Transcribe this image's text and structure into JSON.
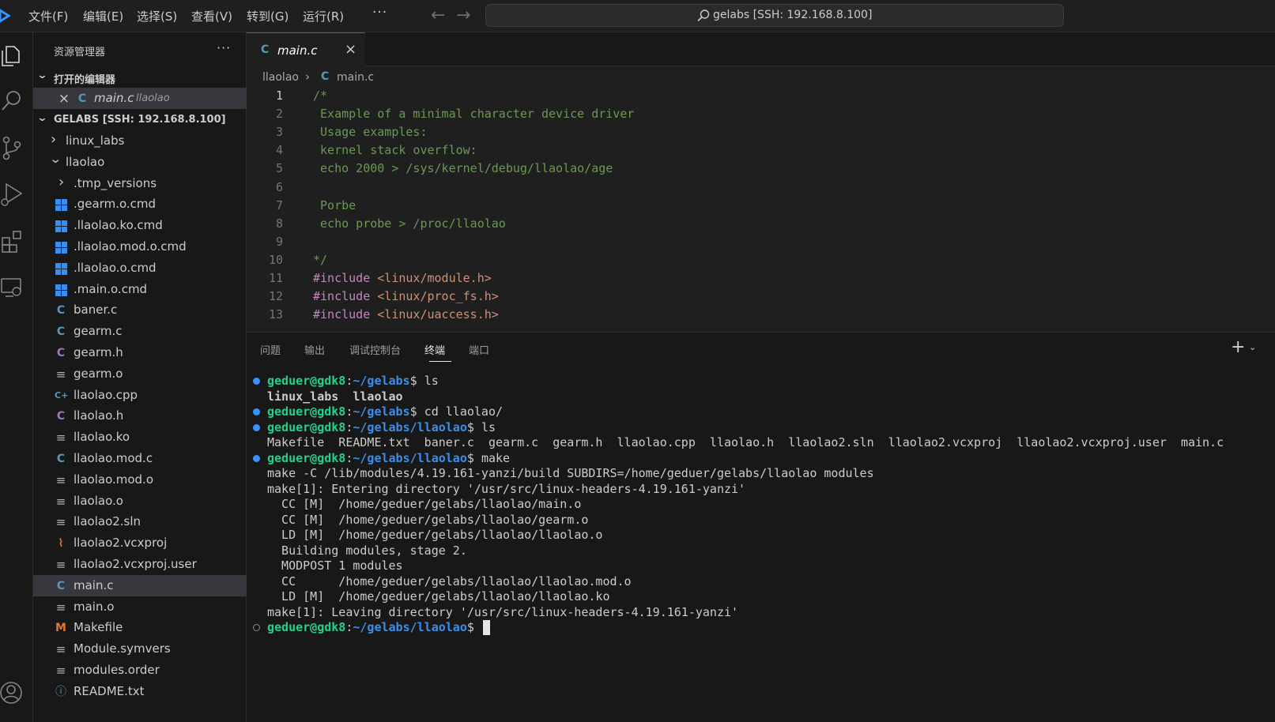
{
  "menu": {
    "items": [
      "文件(F)",
      "编辑(E)",
      "选择(S)",
      "查看(V)",
      "转到(G)",
      "运行(R)"
    ],
    "more": "···"
  },
  "command_center": {
    "text": "gelabs [SSH: 192.168.8.100]"
  },
  "sidebar": {
    "title": "资源管理器",
    "more": "···",
    "open_editors": {
      "header": "打开的编辑器",
      "items": [
        {
          "name": "main.c",
          "folder": "llaolao"
        }
      ]
    },
    "workspace": {
      "header": "GELABS [SSH: 192.168.8.100]",
      "items": [
        {
          "name": "linux_labs",
          "icon": "chevron-right-icon"
        },
        {
          "name": "llaolao",
          "icon": "chevron-down-icon"
        },
        {
          "name": ".tmp_versions",
          "icon": "chevron-right-icon"
        },
        {
          "name": ".gearm.o.cmd",
          "icon": "windows-icon"
        },
        {
          "name": ".llaolao.ko.cmd",
          "icon": "windows-icon"
        },
        {
          "name": ".llaolao.mod.o.cmd",
          "icon": "windows-icon"
        },
        {
          "name": ".llaolao.o.cmd",
          "icon": "windows-icon"
        },
        {
          "name": ".main.o.cmd",
          "icon": "windows-icon"
        },
        {
          "name": "baner.c",
          "icon": "c-file-icon"
        },
        {
          "name": "gearm.c",
          "icon": "c-file-icon"
        },
        {
          "name": "gearm.h",
          "icon": "h-file-icon"
        },
        {
          "name": "gearm.o",
          "icon": "text-file-icon"
        },
        {
          "name": "llaolao.cpp",
          "icon": "cpp-file-icon"
        },
        {
          "name": "llaolao.h",
          "icon": "h-file-icon"
        },
        {
          "name": "llaolao.ko",
          "icon": "text-file-icon"
        },
        {
          "name": "llaolao.mod.c",
          "icon": "c-file-icon"
        },
        {
          "name": "llaolao.mod.o",
          "icon": "text-file-icon"
        },
        {
          "name": "llaolao.o",
          "icon": "text-file-icon"
        },
        {
          "name": "llaolao2.sln",
          "icon": "text-file-icon"
        },
        {
          "name": "llaolao2.vcxproj",
          "icon": "rss-icon"
        },
        {
          "name": "llaolao2.vcxproj.user",
          "icon": "text-file-icon"
        },
        {
          "name": "main.c",
          "icon": "c-file-icon"
        },
        {
          "name": "main.o",
          "icon": "text-file-icon"
        },
        {
          "name": "Makefile",
          "icon": "makefile-icon"
        },
        {
          "name": "Module.symvers",
          "icon": "text-file-icon"
        },
        {
          "name": "modules.order",
          "icon": "text-file-icon"
        },
        {
          "name": "README.txt",
          "icon": "info-icon"
        }
      ]
    }
  },
  "editor": {
    "tab": {
      "label": "main.c",
      "icon": "C"
    },
    "breadcrumb": {
      "folder": "llaolao",
      "sep": "›",
      "icon": "C",
      "file": "main.c"
    },
    "lines": [
      {
        "n": "1",
        "text": "/*",
        "kind": "cm"
      },
      {
        "n": "2",
        "text": " Example of a minimal character device driver",
        "kind": "cm"
      },
      {
        "n": "3",
        "text": " Usage examples:",
        "kind": "cm"
      },
      {
        "n": "4",
        "text": " kernel stack overflow:",
        "kind": "cm"
      },
      {
        "n": "5",
        "text": " echo 2000 > /sys/kernel/debug/llaolao/age",
        "kind": "cm"
      },
      {
        "n": "6",
        "text": "",
        "kind": "cm"
      },
      {
        "n": "7",
        "text": " Porbe",
        "kind": "cm"
      },
      {
        "n": "8",
        "text": " echo probe > /proc/llaolao",
        "kind": "cm"
      },
      {
        "n": "9",
        "text": "",
        "kind": "cm"
      },
      {
        "n": "10",
        "text": "*/",
        "kind": "cm"
      },
      {
        "n": "11",
        "kw": "#include",
        "str": " <linux/module.h>",
        "kind": "inc"
      },
      {
        "n": "12",
        "kw": "#include",
        "str": " <linux/proc_fs.h>",
        "kind": "inc"
      },
      {
        "n": "13",
        "kw": "#include",
        "str": " <linux/uaccess.h>",
        "kind": "inc"
      }
    ]
  },
  "panel": {
    "tabs": [
      "问题",
      "输出",
      "调试控制台",
      "终端",
      "端口"
    ],
    "active_tab": "终端",
    "add": "+",
    "terminal": {
      "lines": [
        {
          "dot": "filled",
          "user": "geduer@gdk8",
          "path": "~/gelabs",
          "cmd": "ls"
        },
        {
          "dot": "",
          "dirs": "linux_labs  llaolao"
        },
        {
          "dot": "filled",
          "user": "geduer@gdk8",
          "path": "~/gelabs",
          "cmd": "cd llaolao/"
        },
        {
          "dot": "filled",
          "user": "geduer@gdk8",
          "path": "~/gelabs/llaolao",
          "cmd": "ls"
        },
        {
          "dot": "",
          "out": "Makefile  README.txt  baner.c  gearm.c  gearm.h  llaolao.cpp  llaolao.h  llaolao2.sln  llaolao2.vcxproj  llaolao2.vcxproj.user  main.c"
        },
        {
          "dot": "filled",
          "user": "geduer@gdk8",
          "path": "~/gelabs/llaolao",
          "cmd": "make"
        },
        {
          "dot": "",
          "out": "make -C /lib/modules/4.19.161-yanzi/build SUBDIRS=/home/geduer/gelabs/llaolao modules"
        },
        {
          "dot": "",
          "out": "make[1]: Entering directory '/usr/src/linux-headers-4.19.161-yanzi'"
        },
        {
          "dot": "",
          "out": "  CC [M]  /home/geduer/gelabs/llaolao/main.o"
        },
        {
          "dot": "",
          "out": "  CC [M]  /home/geduer/gelabs/llaolao/gearm.o"
        },
        {
          "dot": "",
          "out": "  LD [M]  /home/geduer/gelabs/llaolao/llaolao.o"
        },
        {
          "dot": "",
          "out": "  Building modules, stage 2."
        },
        {
          "dot": "",
          "out": "  MODPOST 1 modules"
        },
        {
          "dot": "",
          "out": "  CC      /home/geduer/gelabs/llaolao/llaolao.mod.o"
        },
        {
          "dot": "",
          "out": "  LD [M]  /home/geduer/gelabs/llaolao/llaolao.ko"
        },
        {
          "dot": "",
          "out": "make[1]: Leaving directory '/usr/src/linux-headers-4.19.161-yanzi'"
        },
        {
          "dot": "hollow",
          "user": "geduer@gdk8",
          "path": "~/gelabs/llaolao",
          "cmd": "",
          "cursor": true
        }
      ]
    }
  },
  "colors": {
    "accent": "#0078d4",
    "comment": "#6a9955",
    "keyword": "#c586c0",
    "string": "#ce9178",
    "term_user": "#23d18b",
    "term_path": "#3b8eea"
  }
}
